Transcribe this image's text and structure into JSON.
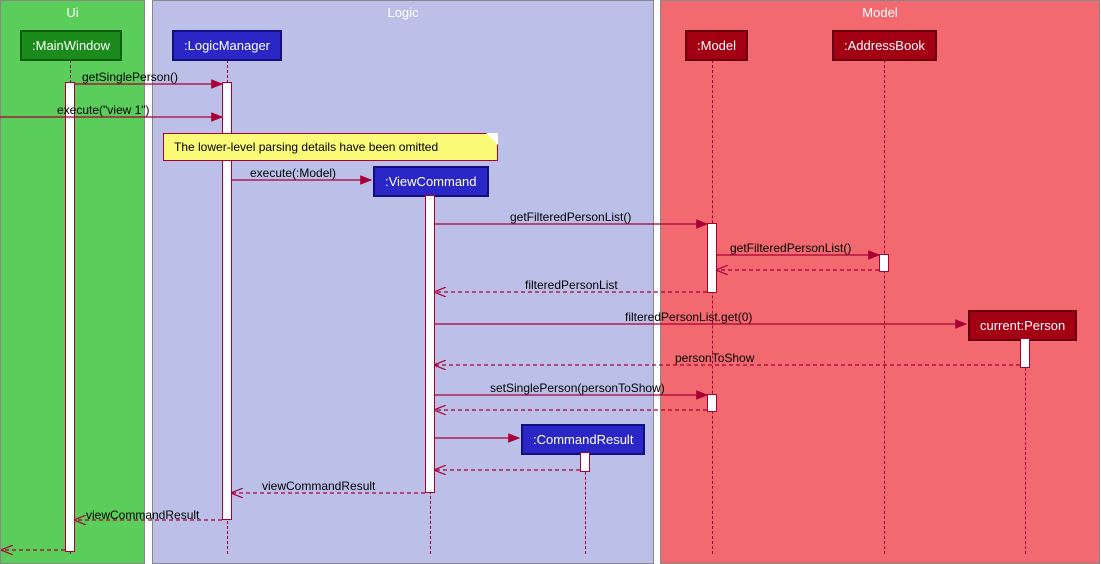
{
  "regions": {
    "ui": {
      "label": "Ui"
    },
    "logic": {
      "label": "Logic"
    },
    "model": {
      "label": "Model"
    }
  },
  "participants": {
    "mainWindow": ":MainWindow",
    "logicManager": ":LogicManager",
    "viewCommand": ":ViewCommand",
    "commandResult": ":CommandResult",
    "model": ":Model",
    "addressBook": ":AddressBook",
    "person": "current:Person"
  },
  "note": "The lower-level parsing details have been omitted",
  "messages": {
    "m1": "getSinglePerson()",
    "m2": "execute(\"view 1\")",
    "m3": "execute(:Model)",
    "m4": "getFilteredPersonList()",
    "m5": "getFilteredPersonList()",
    "m6": "filteredPersonList",
    "m7": "filteredPersonList.get(0)",
    "m8": "personToShow",
    "m9": "setSinglePerson(personToShow)",
    "m10": "viewCommandResult",
    "m11": "viewCommandResult"
  },
  "chart_data": {
    "type": "sequence_diagram",
    "regions": [
      {
        "name": "Ui",
        "participants": [
          ":MainWindow"
        ]
      },
      {
        "name": "Logic",
        "participants": [
          ":LogicManager",
          ":ViewCommand",
          ":CommandResult"
        ]
      },
      {
        "name": "Model",
        "participants": [
          ":Model",
          ":AddressBook",
          "current:Person"
        ]
      }
    ],
    "interactions": [
      {
        "from": ":MainWindow",
        "to": ":LogicManager",
        "label": "getSinglePerson()",
        "type": "sync"
      },
      {
        "from": "(caller)",
        "to": ":LogicManager",
        "label": "execute(\"view 1\")",
        "type": "sync"
      },
      {
        "note": "The lower-level parsing details have been omitted",
        "attached_to": ":LogicManager"
      },
      {
        "from": ":LogicManager",
        "to": ":ViewCommand",
        "label": "execute(:Model)",
        "type": "sync",
        "creates": ":ViewCommand"
      },
      {
        "from": ":ViewCommand",
        "to": ":Model",
        "label": "getFilteredPersonList()",
        "type": "sync"
      },
      {
        "from": ":Model",
        "to": ":AddressBook",
        "label": "getFilteredPersonList()",
        "type": "sync"
      },
      {
        "from": ":AddressBook",
        "to": ":Model",
        "label": "",
        "type": "return"
      },
      {
        "from": ":Model",
        "to": ":ViewCommand",
        "label": "filteredPersonList",
        "type": "return"
      },
      {
        "from": ":ViewCommand",
        "to": "current:Person",
        "label": "filteredPersonList.get(0)",
        "type": "sync",
        "creates": "current:Person"
      },
      {
        "from": "current:Person",
        "to": ":ViewCommand",
        "label": "personToShow",
        "type": "return"
      },
      {
        "from": ":ViewCommand",
        "to": ":Model",
        "label": "setSinglePerson(personToShow)",
        "type": "sync"
      },
      {
        "from": ":Model",
        "to": ":ViewCommand",
        "label": "",
        "type": "return"
      },
      {
        "from": ":ViewCommand",
        "to": ":CommandResult",
        "label": "",
        "type": "sync",
        "creates": ":CommandResult"
      },
      {
        "from": ":CommandResult",
        "to": ":ViewCommand",
        "label": "",
        "type": "return"
      },
      {
        "from": ":ViewCommand",
        "to": ":LogicManager",
        "label": "viewCommandResult",
        "type": "return"
      },
      {
        "from": ":LogicManager",
        "to": ":MainWindow",
        "label": "viewCommandResult",
        "type": "return"
      },
      {
        "from": ":MainWindow",
        "to": "(caller)",
        "label": "",
        "type": "return"
      }
    ]
  }
}
